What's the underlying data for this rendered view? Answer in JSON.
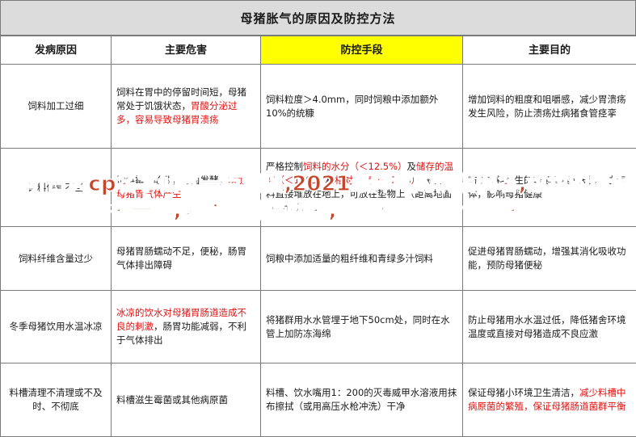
{
  "title": "母猪胀气的原因及防控方法",
  "headers": [
    "发病原因",
    "主要危害",
    "防控手段",
    "主要目的"
  ],
  "rows": [
    {
      "cause": "饲料加工过细",
      "harm": [
        {
          "t": "饲料在胃中的停留时间短，母猪常处于饥饿状态，",
          "red": false
        },
        {
          "t": "胃酸分泌过多，容易导致母猪胃溃疡",
          "red": true
        }
      ],
      "control": [
        {
          "t": "饲料粒度＞4.0mm，同时饲粮中添加额外10%的统糠",
          "red": false
        }
      ],
      "goal": [
        {
          "t": "增加饲料的粗度和咀嚼感，减少胃溃疡发生风险，防止溃疡灶病猪食管痉挛",
          "red": false
        }
      ]
    },
    {
      "cause": "饲料保管不当",
      "harm": [
        {
          "t": "饲料霉变酸败，霉菌发酵，",
          "red": false
        },
        {
          "t": "增加母猪胃气体产生",
          "red": true
        }
      ],
      "control": [
        {
          "t": "严格控制",
          "red": false
        },
        {
          "t": "饲料的水分（＜12.5%）",
          "red": true
        },
        {
          "t": "及",
          "red": false
        },
        {
          "t": "储存的温度（＜15℃）",
          "red": true
        },
        {
          "t": "和",
          "red": false
        },
        {
          "t": "相对湿度（＜70%）",
          "red": true
        },
        {
          "t": "；避免饲料直接堆放在地上，可放在垫物上（距离地面10cm处）",
          "red": false
        }
      ],
      "goal": [
        {
          "t": "防止饲料产生的霉菌毒素或发酵产生气体，影响母猪健康",
          "red": false
        }
      ]
    },
    {
      "cause": "饲料纤维含量过少",
      "harm": [
        {
          "t": "母猪胃肠蠕动不足，便秘，肠胃气体排出障碍",
          "red": false
        }
      ],
      "control": [
        {
          "t": "饲粮中添加适量的粗纤维和青绿多汁饲料",
          "red": false
        }
      ],
      "goal": [
        {
          "t": "促进母猪胃肠蠕动，增强其消化吸收功能，预防母猪便秘",
          "red": false
        }
      ]
    },
    {
      "cause": "冬季母猪饮用水温冰凉",
      "harm": [
        {
          "t": "冰凉的饮水对母猪胃肠道造成不良的刺激",
          "red": true
        },
        {
          "t": "，肠胃功能减弱，不利于气体排出",
          "red": false
        }
      ],
      "control": [
        {
          "t": "将猪群用水水管埋于地下50cm处，同时在水管上加防冻海绵",
          "red": false
        }
      ],
      "goal": [
        {
          "t": "防止母猪用水水温过低，降低猪舍环境温度或直接对母猪造成不良应激",
          "red": false
        }
      ]
    },
    {
      "cause": "料槽清理不清理或不及时、不彻底",
      "harm": [
        {
          "t": "料槽滋生霉菌或其他病原菌",
          "red": false
        }
      ],
      "control": [
        {
          "t": "料槽、饮水嘴用1：200的灭毒威甲水溶液用抹布擦拭（或用高压水枪冲洗）干净",
          "red": false
        }
      ],
      "goal": [
        {
          "t": "保证母猪小环境卫生清洁，",
          "red": false
        },
        {
          "t": "减少料槽中病原菌的繁殖，保证母猪肠道菌群平衡",
          "red": true
        }
      ]
    }
  ],
  "watermark": "好听古风cp名字仙气一点情侣,2021最洋气的情侣网名,甜甜的情侣名一对,繁体字情侣网名,好听稀有的情侣网名"
}
